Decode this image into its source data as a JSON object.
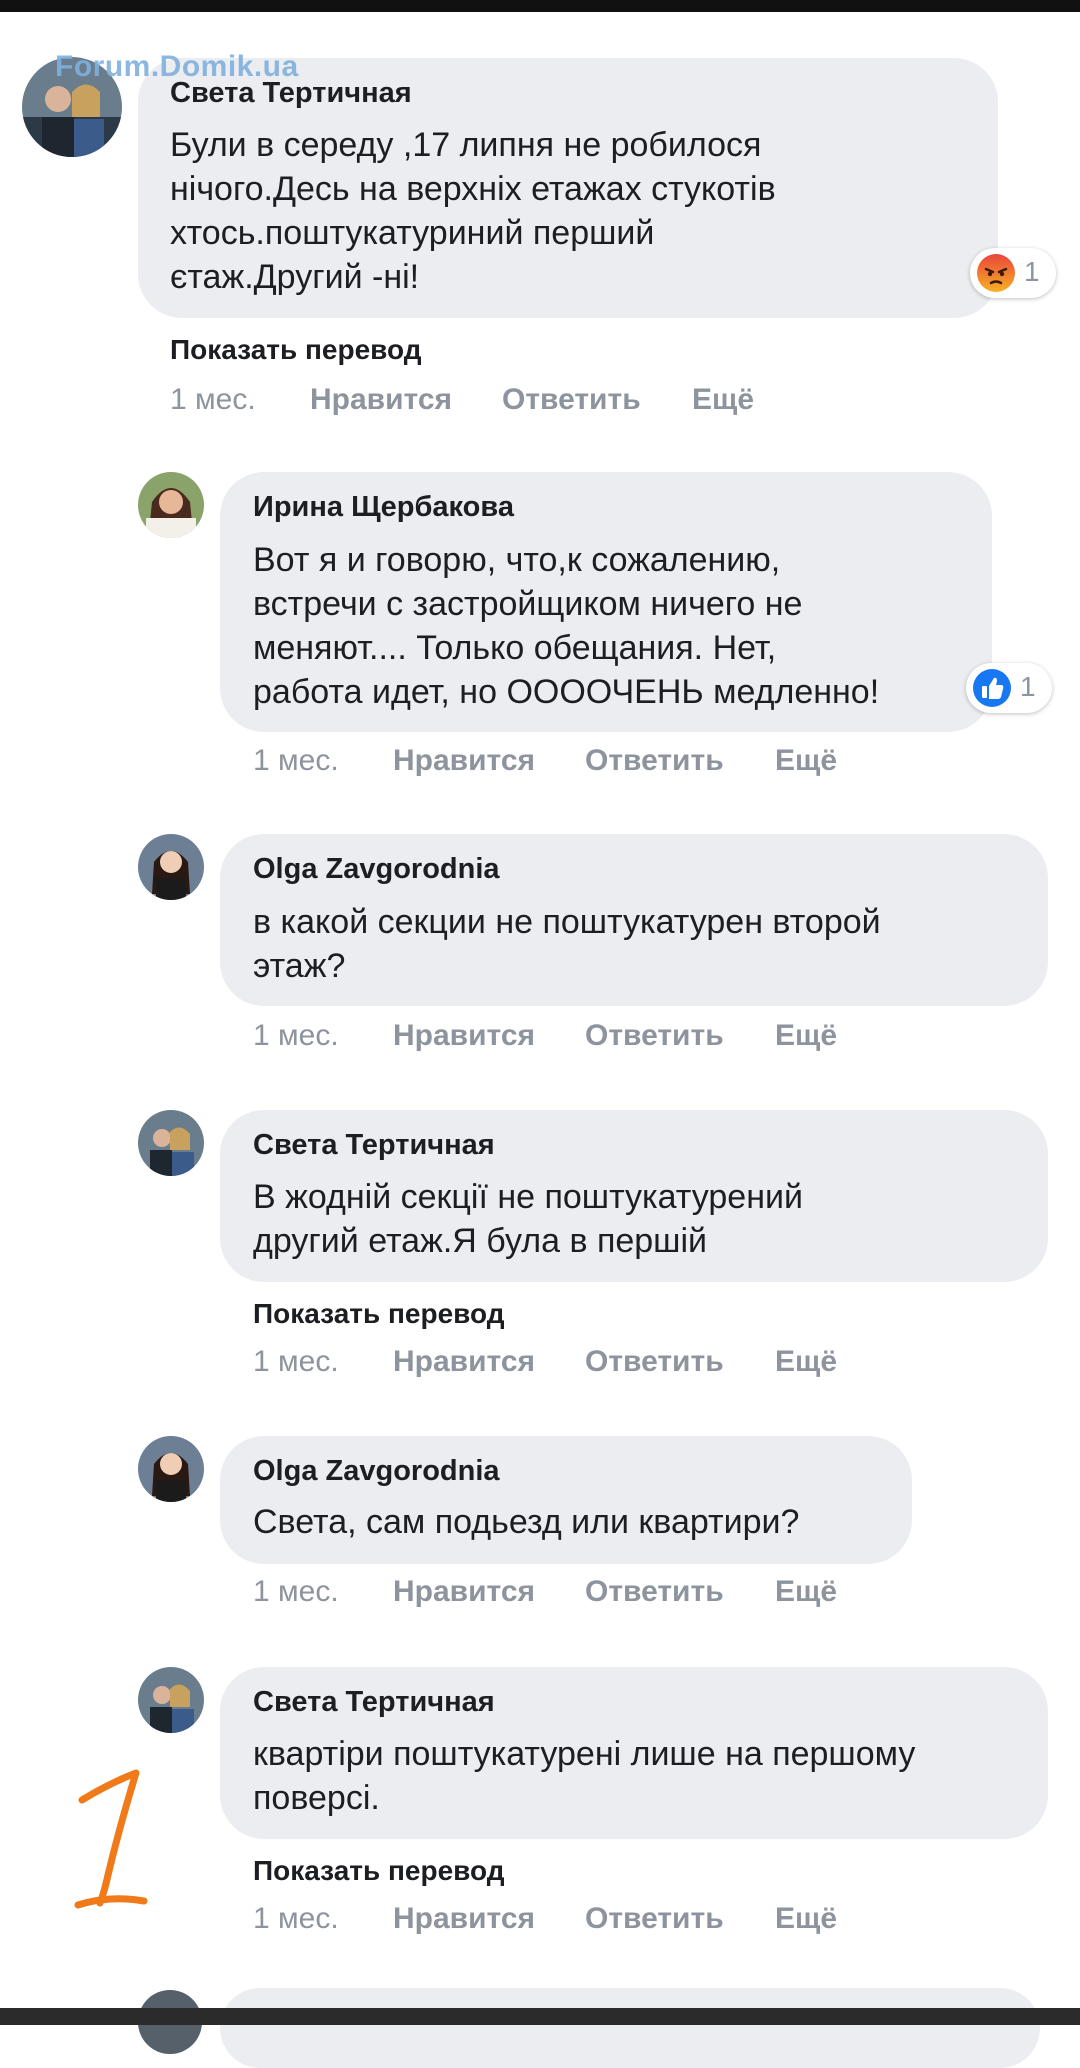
{
  "watermark": "Forum.Domik.ua",
  "comments": [
    {
      "author": "Света Тертичная",
      "text": "Були в середу ,17 липня не робилося\nнічого.Десь на верхніх етажах стукотів\nхтось.поштукатуриний перший\nєтаж.Другий -ні!",
      "translate": "Показать перевод",
      "time": "1 мес.",
      "like": "Нравится",
      "reply": "Ответить",
      "more": "Ещё",
      "reaction": {
        "icon": "angry-reaction-icon",
        "count": "1"
      }
    },
    {
      "author": "Ирина Щербакова",
      "text": "Вот я и говорю, что,к сожалению,\nвстречи с застройщиком ничего не\nменяют.... Только обещания. Нет,\nработа идет, но ООООЧЕНЬ медленно!",
      "time": "1 мес.",
      "like": "Нравится",
      "reply": "Ответить",
      "more": "Ещё",
      "reaction": {
        "icon": "like-reaction-icon",
        "count": "1"
      }
    },
    {
      "author": "Olga Zavgorodnia",
      "text": "в какой секции не поштукатурен второй\nэтаж?",
      "time": "1 мес.",
      "like": "Нравится",
      "reply": "Ответить",
      "more": "Ещё"
    },
    {
      "author": "Света Тертичная",
      "text": "В жодній секції не поштукатурений\nдругий етаж.Я була в першій",
      "translate": "Показать перевод",
      "time": "1 мес.",
      "like": "Нравится",
      "reply": "Ответить",
      "more": "Ещё"
    },
    {
      "author": "Olga Zavgorodnia",
      "text": "Света, сам подьезд или квартири?",
      "time": "1 мес.",
      "like": "Нравится",
      "reply": "Ответить",
      "more": "Ещё"
    },
    {
      "author": "Света Тертичная",
      "text": "квартіри поштукатурені лише на першому\nповерсі.",
      "translate": "Показать перевод",
      "time": "1 мес.",
      "like": "Нравится",
      "reply": "Ответить",
      "more": "Ещё"
    }
  ],
  "annotation": "1",
  "colors": {
    "bubble": "#ebedf0",
    "meta": "#8d949e",
    "text": "#1c1e21",
    "like_blue": "#1877f2",
    "annotation_orange": "#f07a1a"
  }
}
